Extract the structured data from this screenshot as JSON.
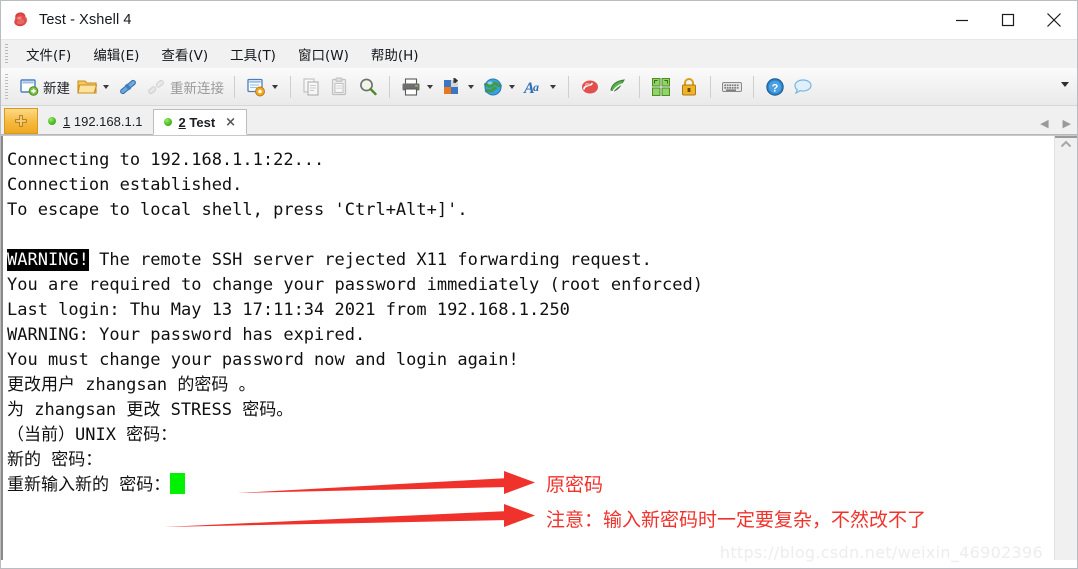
{
  "window": {
    "title": "Test - Xshell 4",
    "app_icon": "xshell-logo-icon",
    "controls": {
      "minimize": "minimize-icon",
      "maximize": "maximize-icon",
      "close": "close-icon"
    }
  },
  "menubar": {
    "items": [
      {
        "label": "文件(F)"
      },
      {
        "label": "编辑(E)"
      },
      {
        "label": "查看(V)"
      },
      {
        "label": "工具(T)"
      },
      {
        "label": "窗口(W)"
      },
      {
        "label": "帮助(H)"
      }
    ]
  },
  "toolbar": {
    "new_label": "新建",
    "reconnect_label": "重新连接",
    "icons": [
      "new-session-icon",
      "open-folder-icon",
      "connect-icon",
      "disconnect-icon",
      "session-properties-icon",
      "copy-icon",
      "paste-icon",
      "find-icon",
      "print-icon",
      "color-scheme-icon",
      "web-icon",
      "font-icon",
      "xshell-icon",
      "xftp-icon",
      "compose-pane-icon",
      "lock-icon",
      "keyboard-icon",
      "help-icon",
      "chat-icon"
    ],
    "overflow": "toolbar-overflow-icon"
  },
  "tabs": {
    "add_button": "new-tab-icon",
    "items": [
      {
        "number": "1",
        "label": "192.168.1.1",
        "active": false,
        "status": "connected"
      },
      {
        "number": "2",
        "label": "Test",
        "active": true,
        "status": "connected",
        "close": "×"
      }
    ],
    "nav_prev": "◀",
    "nav_next": "▶"
  },
  "terminal": {
    "lines": [
      {
        "text": "Connecting to 192.168.1.1:22..."
      },
      {
        "text": "Connection established."
      },
      {
        "text": "To escape to local shell, press 'Ctrl+Alt+]'."
      },
      {
        "text": ""
      },
      {
        "inverted": "WARNING!",
        "text": " The remote SSH server rejected X11 forwarding request."
      },
      {
        "text": "You are required to change your password immediately (root enforced)"
      },
      {
        "text": "Last login: Thu May 13 17:11:34 2021 from 192.168.1.250"
      },
      {
        "text": "WARNING: Your password has expired."
      },
      {
        "text": "You must change your password now and login again!"
      },
      {
        "text": "更改用户 zhangsan 的密码 。"
      },
      {
        "text": "为 zhangsan 更改 STRESS 密码。"
      },
      {
        "text": "（当前）UNIX 密码："
      },
      {
        "text": "新的 密码："
      },
      {
        "text": "重新输入新的 密码：",
        "cursor": true
      }
    ],
    "cursor_color": "#00f200",
    "scrollbar": {
      "up_arrow": "scroll-up-icon"
    }
  },
  "annotations": {
    "color": "#f0322c",
    "items": [
      {
        "text": "原密码",
        "arrow": "arrow-right-icon"
      },
      {
        "text": "注意：输入新密码时一定要复杂，不然改不了",
        "arrow": "arrow-right-icon"
      }
    ]
  },
  "watermark": {
    "text": "https://blog.csdn.net/weixin_46902396"
  }
}
